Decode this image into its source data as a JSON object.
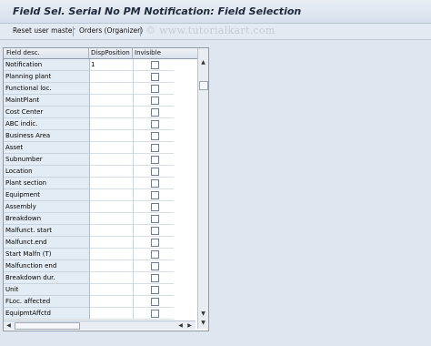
{
  "window": {
    "title": "Field Sel. Serial No PM Notification: Field Selection"
  },
  "toolbar": {
    "reset_label": "Reset user master",
    "orders_label": "Orders (Organizer)"
  },
  "watermark": "© www.tutorialkart.com",
  "table": {
    "columns": [
      "Field desc.",
      "DispPosition",
      "Invisible"
    ],
    "rows": [
      {
        "desc": "Notification",
        "pos": "1"
      },
      {
        "desc": "Planning plant",
        "pos": ""
      },
      {
        "desc": "Functional loc.",
        "pos": ""
      },
      {
        "desc": "MaintPlant",
        "pos": ""
      },
      {
        "desc": "Cost Center",
        "pos": ""
      },
      {
        "desc": "ABC indic.",
        "pos": ""
      },
      {
        "desc": "Business Area",
        "pos": ""
      },
      {
        "desc": "Asset",
        "pos": ""
      },
      {
        "desc": "Subnumber",
        "pos": ""
      },
      {
        "desc": "Location",
        "pos": ""
      },
      {
        "desc": "Plant section",
        "pos": ""
      },
      {
        "desc": "Equipment",
        "pos": ""
      },
      {
        "desc": "Assembly",
        "pos": ""
      },
      {
        "desc": "Breakdown",
        "pos": ""
      },
      {
        "desc": "Malfunct. start",
        "pos": ""
      },
      {
        "desc": "Malfunct.end",
        "pos": ""
      },
      {
        "desc": "Start Malfn (T)",
        "pos": ""
      },
      {
        "desc": "Malfunction end",
        "pos": ""
      },
      {
        "desc": "Breakdown dur.",
        "pos": ""
      },
      {
        "desc": "Unit",
        "pos": ""
      },
      {
        "desc": "FLoc. affected",
        "pos": ""
      },
      {
        "desc": "EquipmtAffctd",
        "pos": ""
      }
    ]
  }
}
